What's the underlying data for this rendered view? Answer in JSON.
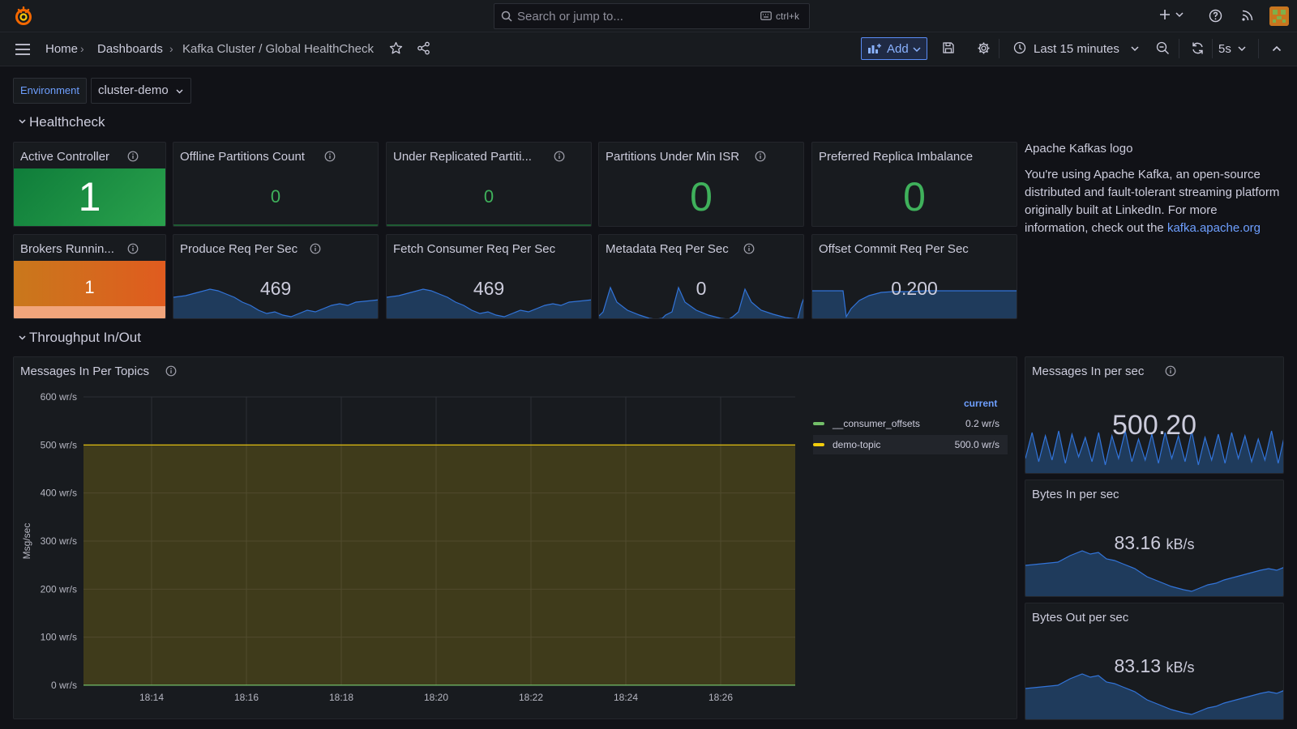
{
  "topbar": {
    "search_placeholder": "Search or jump to...",
    "search_shortcut": "ctrl+k"
  },
  "nav": {
    "breadcrumbs": [
      "Home",
      "Dashboards",
      "Kafka Cluster / Global HealthCheck"
    ],
    "add_label": "Add",
    "time_range": "Last 15 minutes",
    "refresh_interval": "5s"
  },
  "variables": {
    "label": "Environment",
    "value": "cluster-demo"
  },
  "rows": {
    "healthcheck": "Healthcheck",
    "throughput": "Throughput In/Out"
  },
  "colors": {
    "stat_green": "#3fb15b",
    "stat_orange": "#e05b1f",
    "demo_topic": "#f2cc0c",
    "consumer_offsets": "#73bf69",
    "spark": "#3274d9"
  },
  "stats": {
    "active_controller": {
      "title": "Active Controller",
      "value": "1"
    },
    "offline_partitions": {
      "title": "Offline Partitions Count",
      "value": "0"
    },
    "under_replicated": {
      "title": "Under Replicated Partiti...",
      "value": "0"
    },
    "under_min_isr": {
      "title": "Partitions Under Min ISR",
      "value": "0"
    },
    "preferred_replica": {
      "title": "Preferred Replica Imbalance",
      "value": "0"
    },
    "brokers_running": {
      "title": "Brokers Runnin...",
      "value": "1"
    },
    "produce_req": {
      "title": "Produce Req Per Sec",
      "value": "469"
    },
    "fetch_consumer_req": {
      "title": "Fetch Consumer Req Per Sec",
      "value": "469"
    },
    "metadata_req": {
      "title": "Metadata Req Per Sec",
      "value": "0"
    },
    "offset_commit_req": {
      "title": "Offset Commit Req Per Sec",
      "value": "0.200"
    },
    "messages_in": {
      "title": "Messages In per sec",
      "value": "500.20"
    },
    "bytes_in": {
      "title": "Bytes In per sec",
      "value": "83.16",
      "unit": "kB/s"
    },
    "bytes_out": {
      "title": "Bytes Out per sec",
      "value": "83.13",
      "unit": "kB/s"
    }
  },
  "text_panel": {
    "title": "Apache Kafkas logo",
    "body": "You're using Apache Kafka, an open-source distributed and fault-tolerant streaming platform originally built at LinkedIn. For more information, check out the",
    "link": "kafka.apache.org"
  },
  "timeseries": {
    "title": "Messages In Per Topics",
    "legend_header": "current"
  },
  "chart_data": {
    "type": "area",
    "x": [
      "18:14",
      "18:16",
      "18:18",
      "18:20",
      "18:22",
      "18:24",
      "18:26"
    ],
    "ylabel": "Msg/sec",
    "ylim": [
      0,
      600
    ],
    "yticks": [
      "0 wr/s",
      "100 wr/s",
      "200 wr/s",
      "300 wr/s",
      "400 wr/s",
      "500 wr/s",
      "600 wr/s"
    ],
    "series": [
      {
        "name": "__consumer_offsets",
        "values": [
          0.2,
          0.2,
          0.2,
          0.2,
          0.2,
          0.2,
          0.2
        ],
        "current": "0.2 wr/s",
        "color": "#73bf69"
      },
      {
        "name": "demo-topic",
        "values": [
          500,
          500,
          500,
          500,
          500,
          500,
          500
        ],
        "current": "500.0 wr/s",
        "color": "#f2cc0c"
      }
    ],
    "grid": true,
    "legend": "right"
  }
}
